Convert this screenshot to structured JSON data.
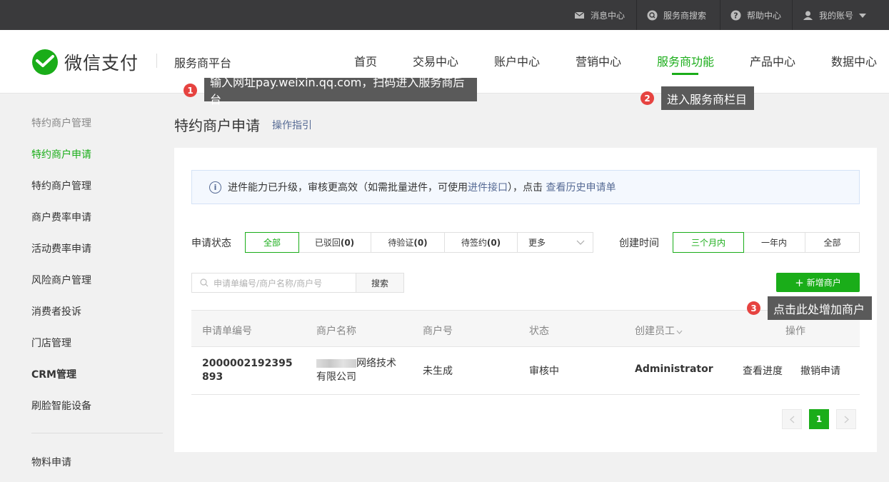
{
  "topbar": {
    "messages": "消息中心",
    "provider_search": "服务商搜索",
    "help": "帮助中心",
    "account": "我的账号"
  },
  "header": {
    "logo_text": "微信支付",
    "platform": "服务商平台",
    "nav": [
      "首页",
      "交易中心",
      "账户中心",
      "营销中心",
      "服务商功能",
      "产品中心",
      "数据中心"
    ],
    "active_nav": "服务商功能"
  },
  "sidebar": {
    "items": [
      "特约商户管理",
      "特约商户申请",
      "特约商户管理",
      "商户费率申请",
      "活动费率申请",
      "风险商户管理",
      "消费者投诉",
      "门店管理",
      "CRM管理",
      "刷脸智能设备",
      "物料申请"
    ]
  },
  "main": {
    "title": "特约商户申请",
    "guide_link": "操作指引",
    "notice": {
      "text1": "进件能力已升级，审核更高效（如需批量进件，可使用 ",
      "link1": "进件接口",
      "text2": "），点击 ",
      "link2": "查看历史申请单"
    },
    "filters": {
      "status_label": "申请状态",
      "status_options": [
        {
          "label": "全部",
          "count": ""
        },
        {
          "label": "已驳回",
          "count": "(0)"
        },
        {
          "label": "待验证",
          "count": "(0)"
        },
        {
          "label": "待签约",
          "count": "(0)"
        },
        {
          "label": "更多",
          "count": ""
        }
      ],
      "time_label": "创建时间",
      "time_options": [
        "三个月内",
        "一年内",
        "全部"
      ]
    },
    "search": {
      "placeholder": "申请单编号/商户名称/商户号",
      "button": "搜索"
    },
    "add_button": "新增商户",
    "table": {
      "headers": [
        "申请单编号",
        "商户名称",
        "商户号",
        "状态",
        "创建员工",
        "操作"
      ],
      "rows": [
        {
          "id_line1": "2000002192395",
          "id_line2": "893",
          "name_line1": "网络技术",
          "name_line2": "有限公司",
          "merchant_no": "未生成",
          "status": "审核中",
          "staff": "Administrator",
          "action1": "查看进度",
          "action2": "撤销申请"
        }
      ]
    },
    "pagination": {
      "current": "1"
    }
  },
  "annotations": [
    {
      "number": "1",
      "text": "输入网址pay.weixin.qq.com，扫码进入服务商后台"
    },
    {
      "number": "2",
      "text": "进入服务商栏目"
    },
    {
      "number": "3",
      "text": "点击此处增加商户"
    }
  ],
  "colors": {
    "brand": "#1aad19",
    "link": "#576b95",
    "badge": "#e64340"
  }
}
